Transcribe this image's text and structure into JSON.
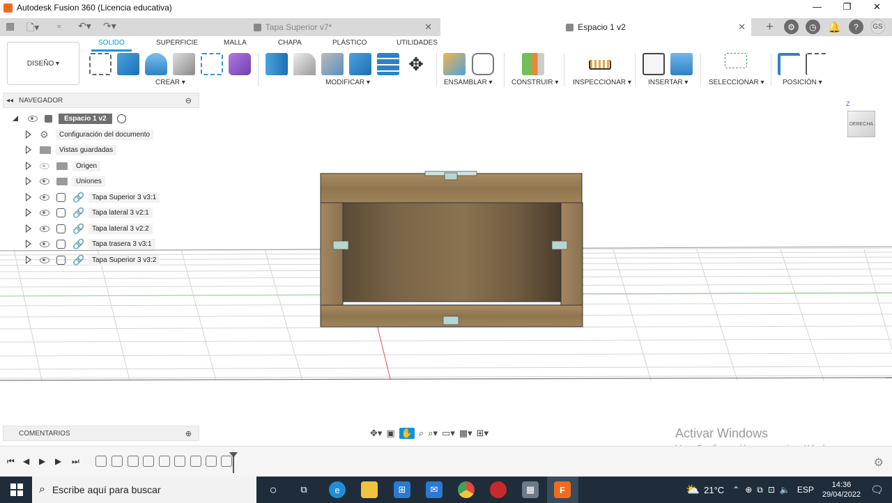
{
  "window": {
    "title": "Autodesk Fusion 360 (Licencia educativa)",
    "controls": [
      "—",
      "❐",
      "✕"
    ]
  },
  "tabs": [
    {
      "label": "Tapa Superior v7*"
    },
    {
      "label": "Espacio 1 v2"
    }
  ],
  "user_initials": "GS",
  "ribbon": {
    "workspace": "DISEÑO ▾",
    "tabs": [
      "SOLIDO",
      "SUPERFICIE",
      "MALLA",
      "CHAPA",
      "PLÁSTICO",
      "UTILIDADES"
    ],
    "groups": [
      "CREAR ▾",
      "MODIFICAR ▾",
      "ENSAMBLAR ▾",
      "CONSTRUIR ▾",
      "INSPECCIONAR ▾",
      "INSERTAR ▾",
      "SELECCIONAR ▾",
      "POSICIÓN ▾"
    ]
  },
  "navigator": {
    "title": "NAVEGADOR",
    "root": "Espacio 1 v2",
    "items": [
      {
        "label": "Configuración del documento",
        "kind": "settings"
      },
      {
        "label": "Vistas guardadas",
        "kind": "folder"
      },
      {
        "label": "Origen",
        "kind": "folder-hidden"
      },
      {
        "label": "Uniones",
        "kind": "folder"
      },
      {
        "label": "Tapa Superior 3 v3:1",
        "kind": "component"
      },
      {
        "label": "Tapa lateral 3 v2:1",
        "kind": "component"
      },
      {
        "label": "Tapa lateral 3 v2:2",
        "kind": "component"
      },
      {
        "label": "Tapa trasera 3 v3:1",
        "kind": "component"
      },
      {
        "label": "Tapa Superior 3 v3:2",
        "kind": "component"
      }
    ]
  },
  "viewcube": {
    "face": "DERECHA",
    "axis": "Z"
  },
  "comments": {
    "title": "COMENTARIOS"
  },
  "watermark": {
    "line1": "Activar Windows",
    "line2": "Ve a Configuración para activar Windows."
  },
  "taskbar": {
    "search_placeholder": "Escribe aquí para buscar",
    "weather": "21°C",
    "language": "ESP",
    "time": "14:36",
    "date": "29/04/2022"
  },
  "colors": {
    "accent": "#0696d7",
    "taskbar": "#1f2d3a",
    "wood": "#9a7f5a"
  }
}
